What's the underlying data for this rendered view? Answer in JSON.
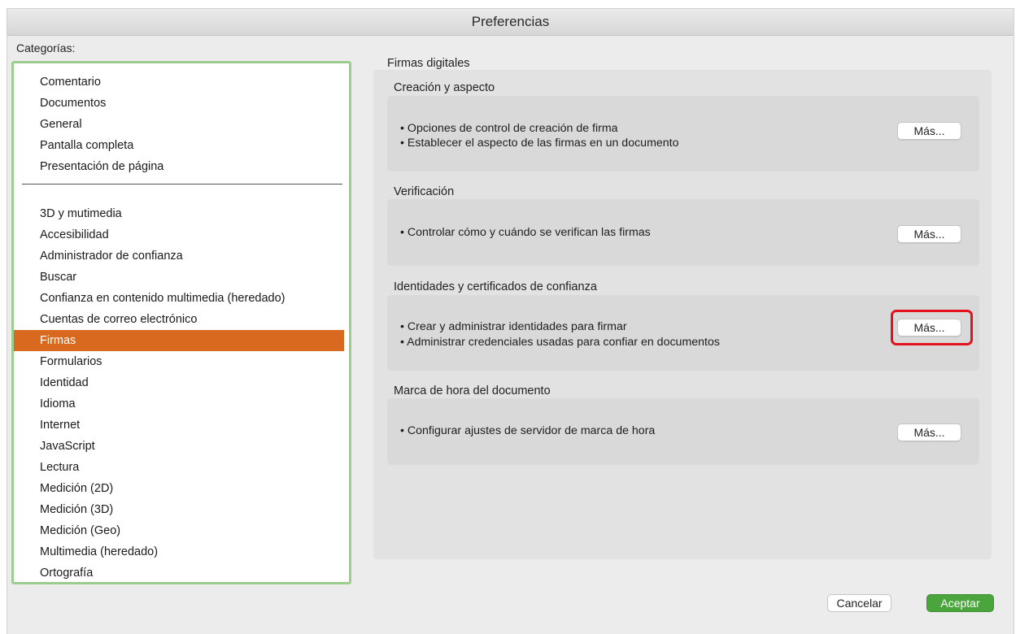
{
  "window": {
    "title": "Preferencias"
  },
  "categories": {
    "label": "Categorías:",
    "top_group": [
      "Comentario",
      "Documentos",
      "General",
      "Pantalla completa",
      "Presentación de página"
    ],
    "bottom_group": [
      "3D y mutimedia",
      "Accesibilidad",
      "Administrador de confianza",
      "Buscar",
      "Confianza en contenido multimedia (heredado)",
      "Cuentas de correo electrónico",
      "Firmas",
      "Formularios",
      "Identidad",
      "Idioma",
      "Internet",
      "JavaScript",
      "Lectura",
      "Medición (2D)",
      "Medición (3D)",
      "Medición (Geo)",
      "Multimedia (heredado)",
      "Ortografía"
    ],
    "selected": "Firmas"
  },
  "main": {
    "title": "Firmas digitales",
    "sections": [
      {
        "title": "Creación y aspecto",
        "lines": [
          "• Opciones de control de creación de firma",
          "• Establecer el aspecto de las firmas en un documento"
        ],
        "button": "Más..."
      },
      {
        "title": "Verificación",
        "lines": [
          "• Controlar cómo y cuándo se verifican las firmas"
        ],
        "button": "Más..."
      },
      {
        "title": "Identidades y certificados de confianza",
        "lines": [
          "• Crear y administrar identidades para firmar",
          "• Administrar credenciales usadas para confiar en documentos"
        ],
        "button": "Más..."
      },
      {
        "title": "Marca de hora del documento",
        "lines": [
          "• Configurar ajustes de servidor de marca de hora"
        ],
        "button": "Más..."
      }
    ]
  },
  "footer": {
    "cancel": "Cancelar",
    "accept": "Aceptar"
  },
  "colors": {
    "selected": "#d9691e",
    "accept": "#4aa53c",
    "highlight": "#e3121c",
    "list_border": "#9ccc8e"
  }
}
